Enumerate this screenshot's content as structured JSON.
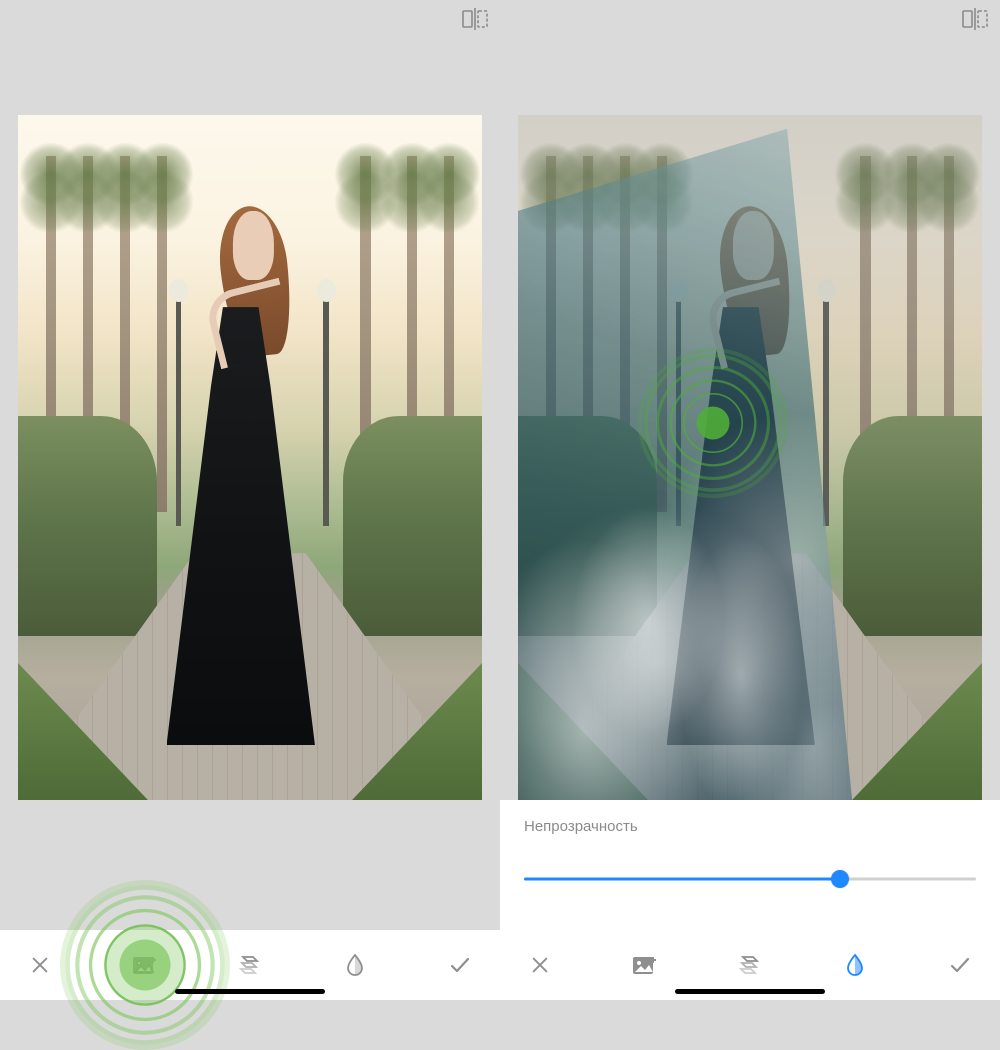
{
  "compare_icon": "compare",
  "left": {
    "toolbar": {
      "cancel": "close",
      "add_image": "add-image",
      "styles": "styles",
      "opacity": "opacity",
      "confirm": "check"
    },
    "highlight": "add_image"
  },
  "right": {
    "opacity_panel": {
      "label": "Непрозрачность",
      "value": 70,
      "min": 0,
      "max": 100
    },
    "toolbar": {
      "cancel": "close",
      "add_image": "add-image",
      "styles": "styles",
      "opacity": "opacity",
      "confirm": "check"
    },
    "active_tool": "opacity"
  },
  "colors": {
    "accent_blue": "#1e88ff",
    "ripple_green": "#6fc24a",
    "icon_grey": "#8f8f8f"
  }
}
